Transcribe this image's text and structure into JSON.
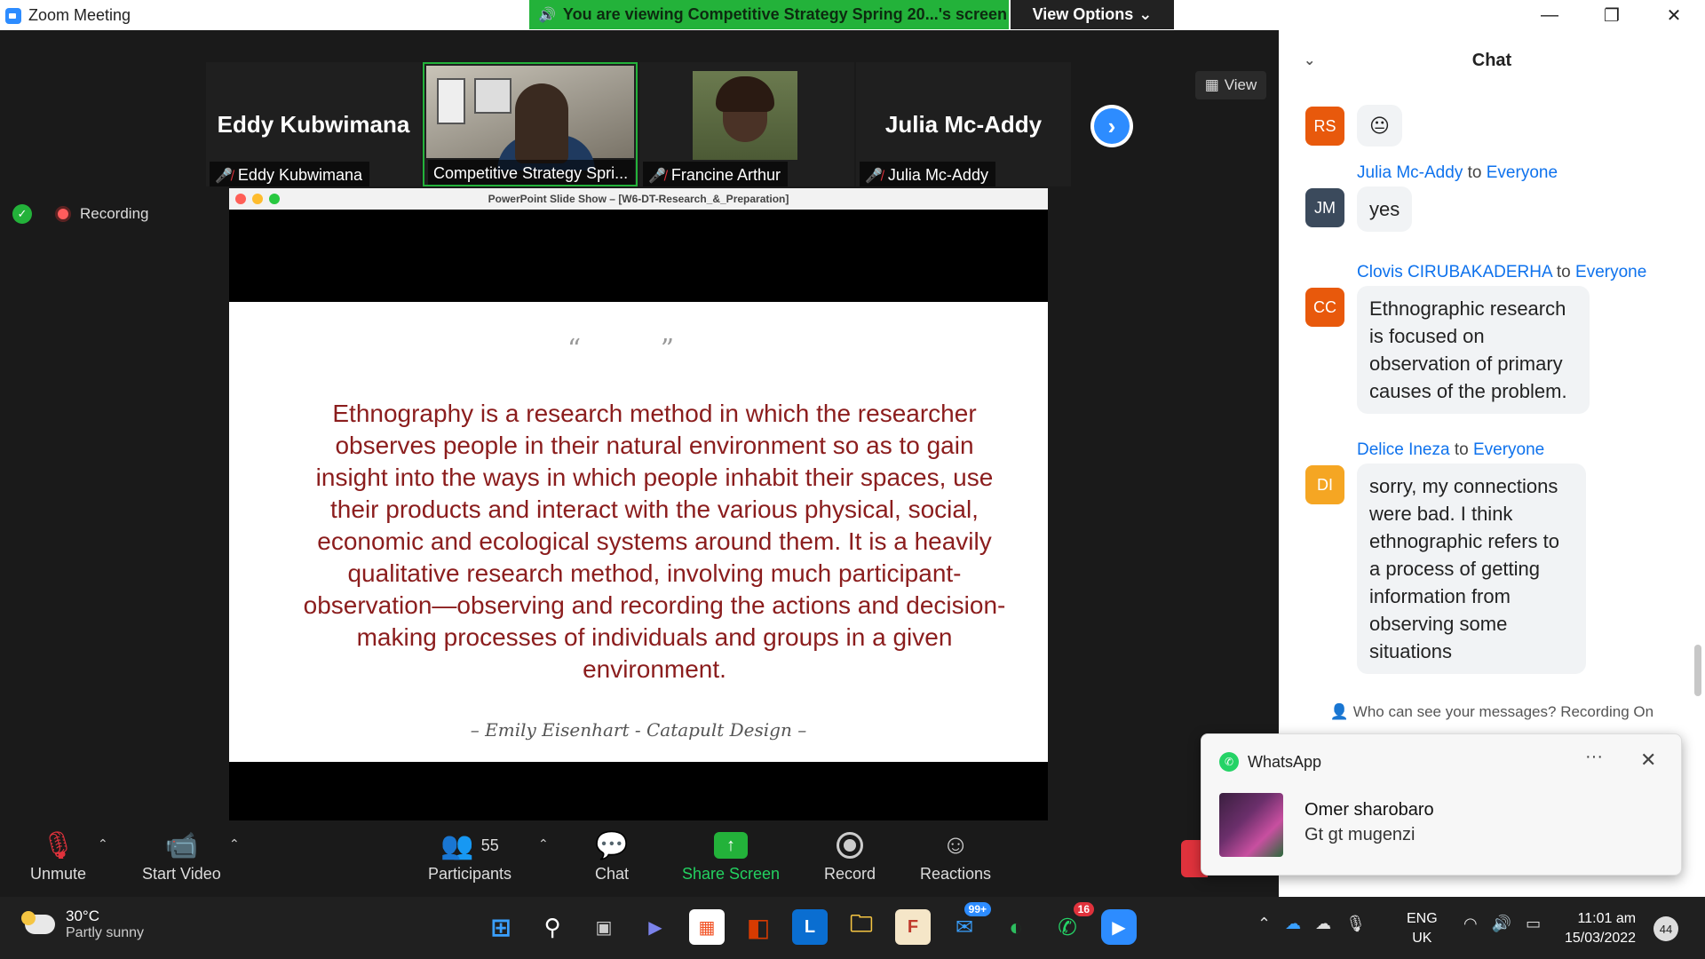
{
  "window": {
    "title": "Zoom Meeting",
    "share_banner": "You are viewing Competitive Strategy Spring 20...'s screen",
    "view_options": "View Options",
    "controls": {
      "minimize": "—",
      "maximize": "❐",
      "close": "✕"
    }
  },
  "participants": [
    {
      "display": "Eddy Kubwimana",
      "tag": "Eddy Kubwimana",
      "muted": true
    },
    {
      "display": "",
      "tag": "Competitive Strategy Spri...",
      "muted": false
    },
    {
      "display": "",
      "tag": "Francine Arthur",
      "muted": true
    },
    {
      "display": "Julia Mc-Addy",
      "tag": "Julia Mc-Addy",
      "muted": true
    }
  ],
  "view_button": "View",
  "recording_label": "Recording",
  "slideshow": {
    "window_title": "PowerPoint Slide Show – [W6-DT-Research_&_Preparation]",
    "quote_marks": "“ ”",
    "quote": "Ethnography is a research method in which the researcher observes people in their natural environment so as to gain insight into the ways in which people inhabit their spaces, use their products and interact with the various physical, social, economic and ecological systems around them. It is a heavily qualitative research method, involving much participant-observation—observing and recording the actions and decision-making processes of individuals and groups in a given environment.",
    "attribution": "– Emily Eisenhart - Catapult Design –"
  },
  "toolbar": {
    "unmute": "Unmute",
    "start_video": "Start Video",
    "participants": "Participants",
    "participants_count": "55",
    "chat": "Chat",
    "share_screen": "Share Screen",
    "record": "Record",
    "reactions": "Reactions"
  },
  "chat": {
    "title": "Chat",
    "messages": [
      {
        "initials": "RS",
        "color": "#e8590c",
        "sender": "",
        "to": "",
        "text": "😐"
      },
      {
        "initials": "JM",
        "color": "#3b4a5c",
        "sender": "Julia Mc-Addy",
        "to": "Everyone",
        "text": "yes"
      },
      {
        "initials": "CC",
        "color": "#e8590c",
        "sender": "Clovis CIRUBAKADERHA",
        "to": "Everyone",
        "text": "Ethnographic research is focused on observation of primary causes of the problem."
      },
      {
        "initials": "DI",
        "color": "#f5a623",
        "sender": "Delice Ineza",
        "to": "Everyone",
        "text": "sorry, my connections were bad. I think ethnographic refers to a process of getting information from observing some situations"
      }
    ],
    "to_word": "to",
    "footer": "Who can see your messages? Recording On"
  },
  "whatsapp": {
    "app": "WhatsApp",
    "sender": "Omer sharobaro",
    "message": "Gt gt mugenzi"
  },
  "taskbar": {
    "temp": "30°C",
    "weather": "Partly sunny",
    "mail_badge": "99+",
    "whatsapp_badge": "16",
    "lang1": "ENG",
    "lang2": "UK",
    "time": "11:01 am",
    "date": "15/03/2022",
    "notifications": "44"
  }
}
